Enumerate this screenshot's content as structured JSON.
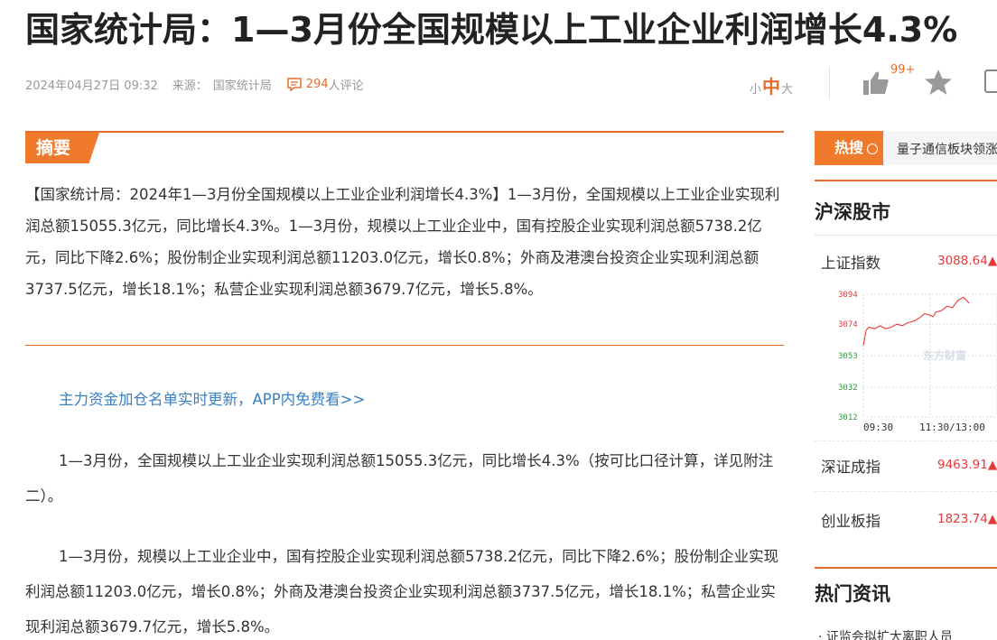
{
  "article": {
    "title": "国家统计局：1—3月份全国规模以上工业企业利润增长4.3%",
    "date": "2024年04月27日 09:32",
    "source_label": "来源：",
    "source": "国家统计局",
    "comment_count": "294",
    "comment_label": "人评论",
    "font_small": "小",
    "font_mid": "中",
    "font_large": "大",
    "like_count": "99+",
    "abstract_label": "摘要",
    "abstract": "【国家统计局：2024年1—3月份全国规模以上工业企业利润增长4.3%】1—3月份，全国规模以上工业企业实现利润总额15055.3亿元，同比增长4.3%。1—3月份，规模以上工业企业中，国有控股企业实现利润总额5738.2亿元，同比下降2.6%；股份制企业实现利润总额11203.0亿元，增长0.8%；外商及港澳台投资企业实现利润总额3737.5亿元，增长18.1%；私营企业实现利润总额3679.7亿元，增长5.8%。",
    "promo_link": "主力资金加仓名单实时更新，APP内免费看>>",
    "paragraphs": [
      "1—3月份，全国规模以上工业企业实现利润总额15055.3亿元，同比增长4.3%（按可比口径计算，详见附注二）。",
      "1—3月份，规模以上工业企业中，国有控股企业实现利润总额5738.2亿元，同比下降2.6%；股份制企业实现利润总额11203.0亿元，增长0.8%；外商及港澳台投资企业实现利润总额3737.5亿元，增长18.1%；私营企业实现利润总额3679.7亿元，增长5.8%。"
    ]
  },
  "sidebar": {
    "hot_search_label": "热搜",
    "hot_search_text": "量子通信板块领涨",
    "market_title": "沪深股市",
    "indices": [
      {
        "name": "上证指数",
        "value": "3088.64▲"
      },
      {
        "name": "深证成指",
        "value": "9463.91▲"
      },
      {
        "name": "创业板指",
        "value": "1823.74▲"
      }
    ],
    "news_title": "热门资讯",
    "news_first": "· 证监会拟扩大离职人员"
  },
  "chart_data": {
    "type": "line",
    "title": "",
    "y_ticks": [
      "3094",
      "3074",
      "3053",
      "3032",
      "3012"
    ],
    "x_ticks": [
      "09:30",
      "11:30/13:00"
    ],
    "ylim": [
      3012,
      3094
    ],
    "watermark": "东方财富",
    "series": [
      {
        "name": "",
        "color": "#e4393c",
        "x": [
          0,
          5,
          10,
          20,
          30,
          40,
          50,
          60,
          70,
          80,
          90,
          100,
          110,
          120,
          125,
          130,
          140,
          150,
          160,
          170,
          180,
          190
        ],
        "values": [
          3060,
          3070,
          3072,
          3071,
          3073,
          3071,
          3072,
          3074,
          3073,
          3075,
          3076,
          3078,
          3081,
          3080,
          3079,
          3082,
          3083,
          3086,
          3085,
          3090,
          3092,
          3088
        ]
      }
    ]
  },
  "colors": {
    "accent": "#e36e2c",
    "up": "#e4393c",
    "link": "#3a7fc1"
  }
}
